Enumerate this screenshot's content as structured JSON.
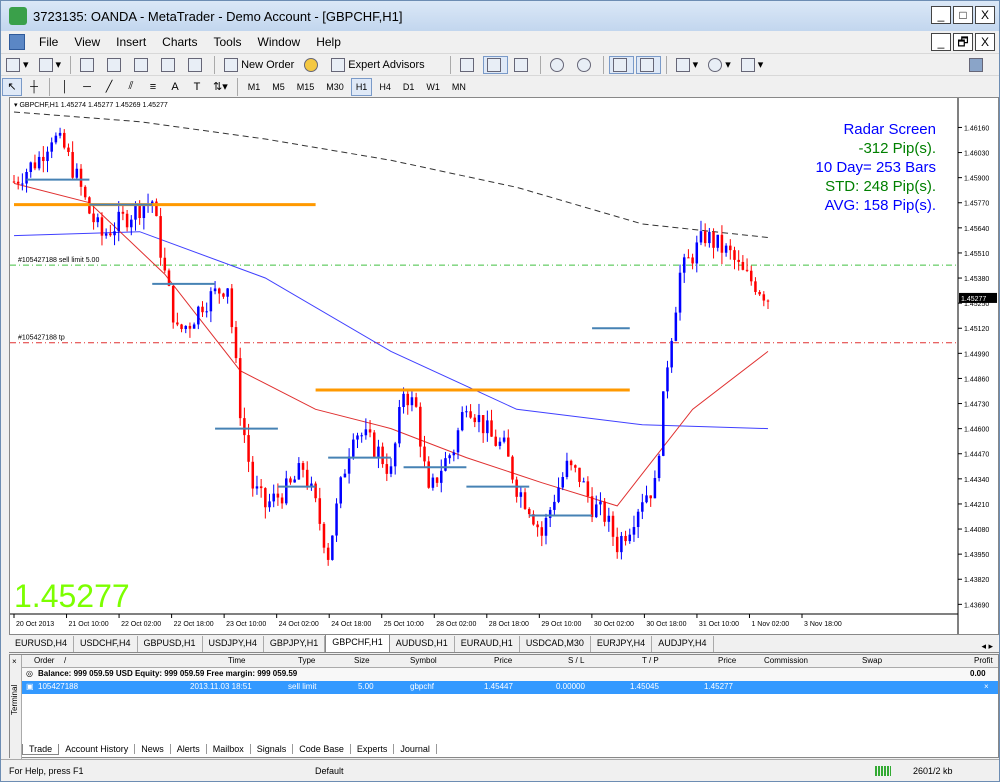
{
  "window": {
    "title": "3723135: OANDA - MetaTrader - Demo Account - [GBPCHF,H1]",
    "min": "_",
    "max": "□",
    "close": "X"
  },
  "menu": [
    "File",
    "View",
    "Insert",
    "Charts",
    "Tools",
    "Window",
    "Help"
  ],
  "mdi": {
    "min": "_",
    "restore": "🗗",
    "close": "X"
  },
  "toolbar": {
    "new_order": "New Order",
    "expert_advisors": "Expert Advisors"
  },
  "timeframes": [
    "M1",
    "M5",
    "M15",
    "M30",
    "H1",
    "H4",
    "D1",
    "W1",
    "MN"
  ],
  "active_timeframe": "H1",
  "chart": {
    "header": "GBPCHF,H1  1.45274 1.45277 1.45269 1.45277",
    "big_price": "1.45277",
    "sell_limit_label": "#105427188 sell limit 5.00",
    "tp_label": "#105427188 tp",
    "radar": [
      {
        "text": "Radar Screen",
        "color": "#0000ff"
      },
      {
        "text": "-312 Pip(s).",
        "color": "#008000"
      },
      {
        "text": "10 Day= 253 Bars",
        "color": "#0000ff"
      },
      {
        "text": "STD: 248 Pip(s).",
        "color": "#008000"
      },
      {
        "text": "AVG: 158 Pip(s).",
        "color": "#0000ff"
      }
    ],
    "current_price_label": "1.45277",
    "colors": {
      "up": "#0000ff",
      "down": "#ff0000",
      "orange": "#ff9900",
      "steel": "#4682b4",
      "ma_slow": "#333333",
      "ma_blue": "#4040ff",
      "ma_red": "#e03030",
      "sell_line": "#40c040",
      "tp_line": "#e03030"
    }
  },
  "chart_data": {
    "type": "candlestick",
    "y_ticks": [
      "1.46160",
      "1.46030",
      "1.45900",
      "1.45770",
      "1.45640",
      "1.45510",
      "1.45380",
      "1.45250",
      "1.45120",
      "1.44990",
      "1.44860",
      "1.44730",
      "1.44600",
      "1.44470",
      "1.44340",
      "1.44210",
      "1.44080",
      "1.43950",
      "1.43820",
      "1.43690"
    ],
    "x_ticks": [
      "20 Oct 2013",
      "21 Oct 10:00",
      "22 Oct 02:00",
      "22 Oct 18:00",
      "23 Oct 10:00",
      "24 Oct 02:00",
      "24 Oct 18:00",
      "25 Oct 10:00",
      "28 Oct 02:00",
      "28 Oct 18:00",
      "29 Oct 10:00",
      "30 Oct 02:00",
      "30 Oct 18:00",
      "31 Oct 10:00",
      "1 Nov 02:00",
      "3 Nov 18:00"
    ],
    "ylim": [
      1.4364,
      1.4624
    ],
    "sell_limit": 1.45447,
    "take_profit": 1.45045,
    "close_path": [
      [
        0,
        1.4588
      ],
      [
        3,
        1.4594
      ],
      [
        6,
        1.46
      ],
      [
        9,
        1.4612
      ],
      [
        12,
        1.4605
      ],
      [
        15,
        1.459
      ],
      [
        18,
        1.4572
      ],
      [
        21,
        1.456
      ],
      [
        24,
        1.4565
      ],
      [
        27,
        1.457
      ],
      [
        30,
        1.4575
      ],
      [
        33,
        1.4578
      ],
      [
        36,
        1.454
      ],
      [
        39,
        1.451
      ],
      [
        42,
        1.4515
      ],
      [
        45,
        1.4525
      ],
      [
        48,
        1.453
      ],
      [
        51,
        1.4535
      ],
      [
        54,
        1.447
      ],
      [
        57,
        1.443
      ],
      [
        60,
        1.442
      ],
      [
        63,
        1.4425
      ],
      [
        66,
        1.443
      ],
      [
        69,
        1.444
      ],
      [
        72,
        1.442
      ],
      [
        75,
        1.4395
      ],
      [
        78,
        1.443
      ],
      [
        81,
        1.446
      ],
      [
        84,
        1.4455
      ],
      [
        87,
        1.4448
      ],
      [
        90,
        1.4437
      ],
      [
        93,
        1.448
      ],
      [
        96,
        1.447
      ],
      [
        99,
        1.4425
      ],
      [
        102,
        1.444
      ],
      [
        105,
        1.445
      ],
      [
        108,
        1.4475
      ],
      [
        111,
        1.4465
      ],
      [
        114,
        1.4455
      ],
      [
        117,
        1.445
      ],
      [
        120,
        1.443
      ],
      [
        123,
        1.442
      ],
      [
        126,
        1.4405
      ],
      [
        129,
        1.4425
      ],
      [
        132,
        1.444
      ],
      [
        135,
        1.4435
      ],
      [
        138,
        1.442
      ],
      [
        141,
        1.4415
      ],
      [
        144,
        1.44
      ],
      [
        147,
        1.441
      ],
      [
        150,
        1.4425
      ],
      [
        153,
        1.443
      ],
      [
        156,
        1.4495
      ],
      [
        159,
        1.454
      ],
      [
        162,
        1.455
      ],
      [
        165,
        1.456
      ],
      [
        168,
        1.4555
      ],
      [
        171,
        1.455
      ],
      [
        174,
        1.454
      ],
      [
        177,
        1.4535
      ],
      [
        180,
        1.4528
      ]
    ],
    "orange_levels": [
      {
        "x0": 0,
        "x1": 72,
        "y": 1.4576
      },
      {
        "x0": 72,
        "x1": 147,
        "y": 1.448
      }
    ],
    "steel_levels": [
      {
        "x0": 3,
        "x1": 18,
        "y": 1.4589
      },
      {
        "x0": 18,
        "x1": 33,
        "y": 1.4576
      },
      {
        "x0": 33,
        "x1": 48,
        "y": 1.4535
      },
      {
        "x0": 48,
        "x1": 63,
        "y": 1.446
      },
      {
        "x0": 63,
        "x1": 72,
        "y": 1.443
      },
      {
        "x0": 75,
        "x1": 90,
        "y": 1.4445
      },
      {
        "x0": 93,
        "x1": 108,
        "y": 1.444
      },
      {
        "x0": 108,
        "x1": 123,
        "y": 1.443
      },
      {
        "x0": 123,
        "x1": 138,
        "y": 1.4415
      },
      {
        "x0": 138,
        "x1": 147,
        "y": 1.4512
      }
    ],
    "ma_slow": [
      [
        0,
        1.4624
      ],
      [
        30,
        1.4619
      ],
      [
        60,
        1.461
      ],
      [
        90,
        1.4599
      ],
      [
        120,
        1.4585
      ],
      [
        150,
        1.4566
      ],
      [
        180,
        1.4559
      ]
    ],
    "ma_blue": [
      [
        0,
        1.456
      ],
      [
        30,
        1.4562
      ],
      [
        60,
        1.4538
      ],
      [
        90,
        1.45
      ],
      [
        120,
        1.447
      ],
      [
        150,
        1.4462
      ],
      [
        180,
        1.446
      ]
    ],
    "ma_red": [
      [
        0,
        1.4587
      ],
      [
        18,
        1.4577
      ],
      [
        36,
        1.454
      ],
      [
        54,
        1.449
      ],
      [
        72,
        1.447
      ],
      [
        90,
        1.446
      ],
      [
        108,
        1.4445
      ],
      [
        126,
        1.4432
      ],
      [
        144,
        1.442
      ],
      [
        162,
        1.447
      ],
      [
        180,
        1.45
      ]
    ]
  },
  "symbol_tabs": [
    "EURUSD,H4",
    "USDCHF,H4",
    "GBPUSD,H1",
    "USDJPY,H4",
    "GBPJPY,H1",
    "GBPCHF,H1",
    "AUDUSD,H1",
    "EURAUD,H1",
    "USDCAD,M30",
    "EURJPY,H4",
    "AUDJPY,H4"
  ],
  "active_symbol_tab": "GBPCHF,H1",
  "terminal": {
    "side_label": "Terminal",
    "close": "×",
    "columns": [
      "Order",
      "/",
      "Time",
      "Type",
      "Size",
      "Symbol",
      "Price",
      "S / L",
      "T / P",
      "Price",
      "Commission",
      "Swap",
      "Profit"
    ],
    "balance_line": "Balance: 999 059.59 USD  Equity: 999 059.59  Free margin: 999 059.59",
    "balance_profit": "0.00",
    "order": {
      "id": "105427188",
      "time": "2013.11.03 18:51",
      "type": "sell limit",
      "size": "5.00",
      "symbol": "gbpchf",
      "price": "1.45447",
      "sl": "0.00000",
      "tp": "1.45045",
      "cur_price": "1.45277",
      "close_x": "×"
    },
    "tabs": [
      "Trade",
      "Account History",
      "News",
      "Alerts",
      "Mailbox",
      "Signals",
      "Code Base",
      "Experts",
      "Journal"
    ],
    "active_tab": "Trade"
  },
  "status": {
    "help": "For Help, press F1",
    "profile": "Default",
    "traffic": "2601/2 kb"
  }
}
